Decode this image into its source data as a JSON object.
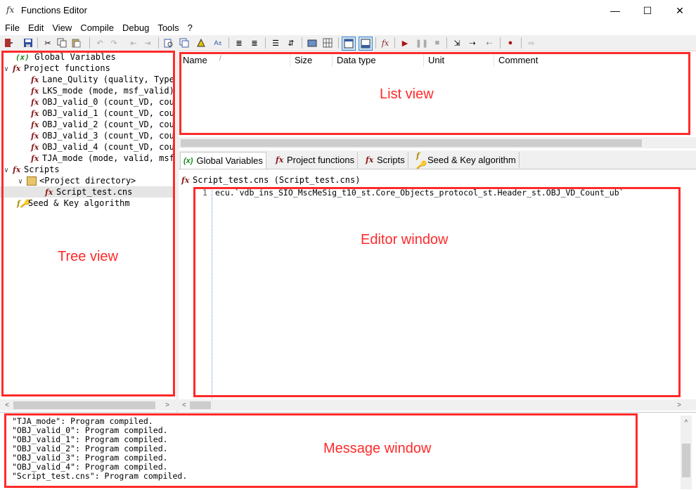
{
  "window": {
    "title": "Functions Editor",
    "icon": "fx-icon",
    "controls": [
      "—",
      "☐",
      "✕"
    ]
  },
  "menu": [
    "File",
    "Edit",
    "View",
    "Compile",
    "Debug",
    "Tools",
    "?"
  ],
  "tree": {
    "items": [
      {
        "label": "Global Variables",
        "icon": "(x)"
      },
      {
        "label": "Project functions",
        "icon": "fx",
        "expander": "∨"
      },
      {
        "label": "Lane_Qulity (quality, Type",
        "icon": "fx"
      },
      {
        "label": "LKS_mode (mode, msf_valid)",
        "icon": "fx"
      },
      {
        "label": "OBJ_valid_0 (count_VD, cou",
        "icon": "fx"
      },
      {
        "label": "OBJ_valid_1 (count_VD, cou",
        "icon": "fx"
      },
      {
        "label": "OBJ_valid_2 (count_VD, cou",
        "icon": "fx"
      },
      {
        "label": "OBJ_valid_3 (count_VD, cou",
        "icon": "fx"
      },
      {
        "label": "OBJ_valid_4 (count_VD, cou",
        "icon": "fx"
      },
      {
        "label": "TJA_mode (mode, valid, msf",
        "icon": "fx"
      },
      {
        "label": "Scripts",
        "icon": "fx",
        "expander": "∨"
      },
      {
        "label": "<Project directory>",
        "icon": "folder",
        "expander": "∨"
      },
      {
        "label": "Script_test.cns",
        "icon": "fx"
      },
      {
        "label": "Seed & Key algorithm",
        "icon": "key"
      }
    ]
  },
  "list_view": {
    "columns": [
      "Name",
      "Size",
      "Data type",
      "Unit",
      "Comment"
    ],
    "sort_indicator": "/"
  },
  "tabs": [
    {
      "label": "Global Variables",
      "icon": "(x)"
    },
    {
      "label": "Project functions",
      "icon": "fx"
    },
    {
      "label": "Scripts",
      "icon": "fx"
    },
    {
      "label": "Seed & Key algorithm",
      "icon": "key"
    }
  ],
  "editor": {
    "title": "Script_test.cns (Script_test.cns)",
    "line_number": "1",
    "code": "ecu.`vdb_ins_SIO_MscMeSig_t10_st.Core_Objects_protocol_st.Header_st.OBJ_VD_Count_ub`"
  },
  "messages": [
    "\"TJA_mode\": Program compiled.",
    "\"OBJ_valid_0\": Program compiled.",
    "\"OBJ_valid_1\": Program compiled.",
    "\"OBJ_valid_2\": Program compiled.",
    "\"OBJ_valid_3\": Program compiled.",
    "\"OBJ_valid_4\": Program compiled.",
    "\"Script_test.cns\": Program compiled."
  ],
  "annotations": {
    "tree": "Tree view",
    "list": "List view",
    "editor": "Editor window",
    "message": "Message window",
    "color": "#ff2a2a"
  }
}
